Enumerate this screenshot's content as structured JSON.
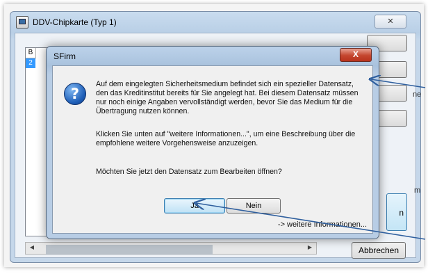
{
  "background_window": {
    "title": "DDV-Chipkarte (Typ 1)",
    "close_label": "✕",
    "list_header": "B",
    "list_row": "2",
    "highlight_button_label": "n",
    "cancel_label": "Abbrechen",
    "scroll_left": "◀",
    "scroll_right": "▶"
  },
  "dialog": {
    "title": "SFirm",
    "close_label": "X",
    "icon": "question-icon",
    "message_1": "Auf dem eingelegten Sicherheitsmedium befindet sich ein spezieller Datensatz, den das Kreditinstitut bereits für Sie angelegt hat. Bei diesem Datensatz müssen nur noch einige Angaben vervollständigt werden, bevor Sie das Medium für die Übertragung nutzen können.",
    "message_2": "Klicken Sie unten auf \"weitere Informationen...\", um eine Beschreibung über die empfohlene weitere Vorgehensweise anzuzeigen.",
    "message_3": "Möchten Sie jetzt den Datensatz zum Bearbeiten öffnen?",
    "yes_label": "Ja",
    "no_label": "Nein",
    "more_info_label": "-> weitere Informationen..."
  },
  "side_text": {
    "right_top": "ne",
    "right_mid": "m"
  },
  "colors": {
    "annotation_arrow": "#2f5f9e",
    "dialog_close": "#c4452e",
    "info_icon": "#1f5fb8"
  }
}
